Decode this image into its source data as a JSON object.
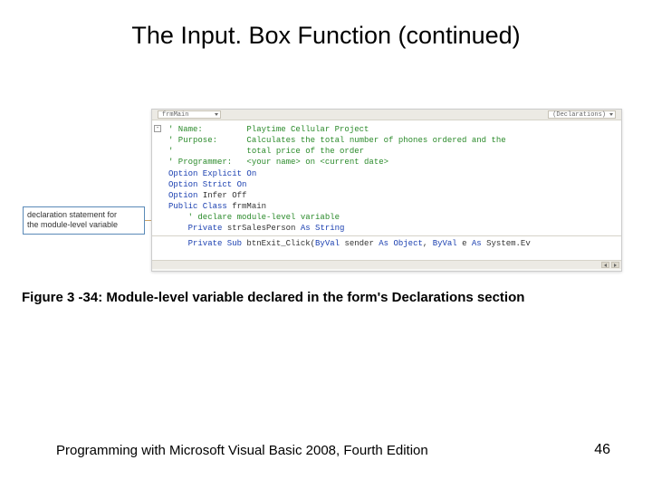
{
  "title": "The Input. Box Function (continued)",
  "callout": {
    "line1": "declaration statement for",
    "line2": "the module-level variable"
  },
  "editor": {
    "dropdown_left": "frmMain",
    "dropdown_right": "(Declarations)",
    "lines": {
      "l1": "' Name:         Playtime Cellular Project",
      "l2": "' Purpose:      Calculates the total number of phones ordered and the",
      "l3": "'               total price of the order",
      "l4": "' Programmer:   <your name> on <current date>",
      "l5": "",
      "l6a": "Option Explicit ",
      "l6b": "On",
      "l7a": "Option Strict ",
      "l7b": "On",
      "l8a": "Option ",
      "l8b": "Infer Off",
      "l9": "",
      "l10a": "Public Class",
      "l10b": " frmMain",
      "l11": "",
      "l12": "    ' declare module-level variable",
      "l13a": "    Private",
      "l13b": " strSalesPerson ",
      "l13c": "As String",
      "l14": "",
      "l15a": "    Private Sub",
      "l15b": " btnExit_Click(",
      "l15c": "ByVal",
      "l15d": " sender ",
      "l15e": "As Object",
      "l15f": ", ",
      "l15g": "ByVal",
      "l15h": " e ",
      "l15i": "As",
      "l15j": " System.Ev"
    }
  },
  "caption": "Figure 3 -34: Module-level variable declared in the form's Declarations section",
  "footer": "Programming with Microsoft Visual Basic 2008, Fourth Edition",
  "page": "46"
}
